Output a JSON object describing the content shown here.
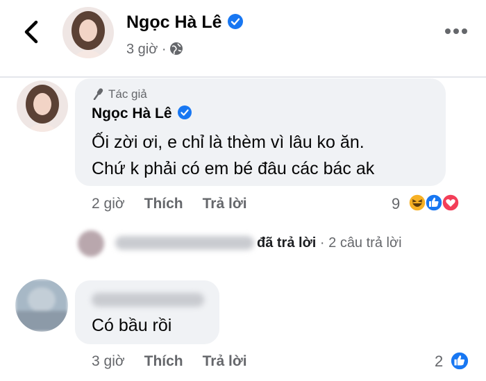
{
  "header": {
    "title": "Ngọc Hà Lê",
    "time": "3 giờ ·",
    "icons": [
      "back-arrow-icon",
      "verified-badge-icon",
      "globe-icon",
      "more-options-icon"
    ]
  },
  "comment1": {
    "author_tag": "Tác giả",
    "name": "Ngọc Hà Lê",
    "line1": "Ối zời ơi, e chỉ là thèm vì lâu ko ăn.",
    "line2": "Chứ k phải có em bé đâu các bác ak",
    "time": "2 giờ",
    "like": "Thích",
    "reply": "Trả lời",
    "reaction_count": "9",
    "reactions": [
      "haha-icon",
      "like-icon",
      "love-icon"
    ]
  },
  "reply_summary": {
    "action": "đã trả lời",
    "count": " · 2 câu trả lời"
  },
  "comment2": {
    "text": "Có bầu rồi",
    "time": "3 giờ",
    "like": "Thích",
    "reply": "Trả lời",
    "reaction_count": "2",
    "reactions": [
      "like-icon"
    ]
  },
  "colors": {
    "brand_blue": "#1877f2",
    "bubble": "#f0f2f5",
    "secondary_text": "#65676b",
    "love_red": "#f33e58",
    "haha_yellow": "#f7b125"
  }
}
